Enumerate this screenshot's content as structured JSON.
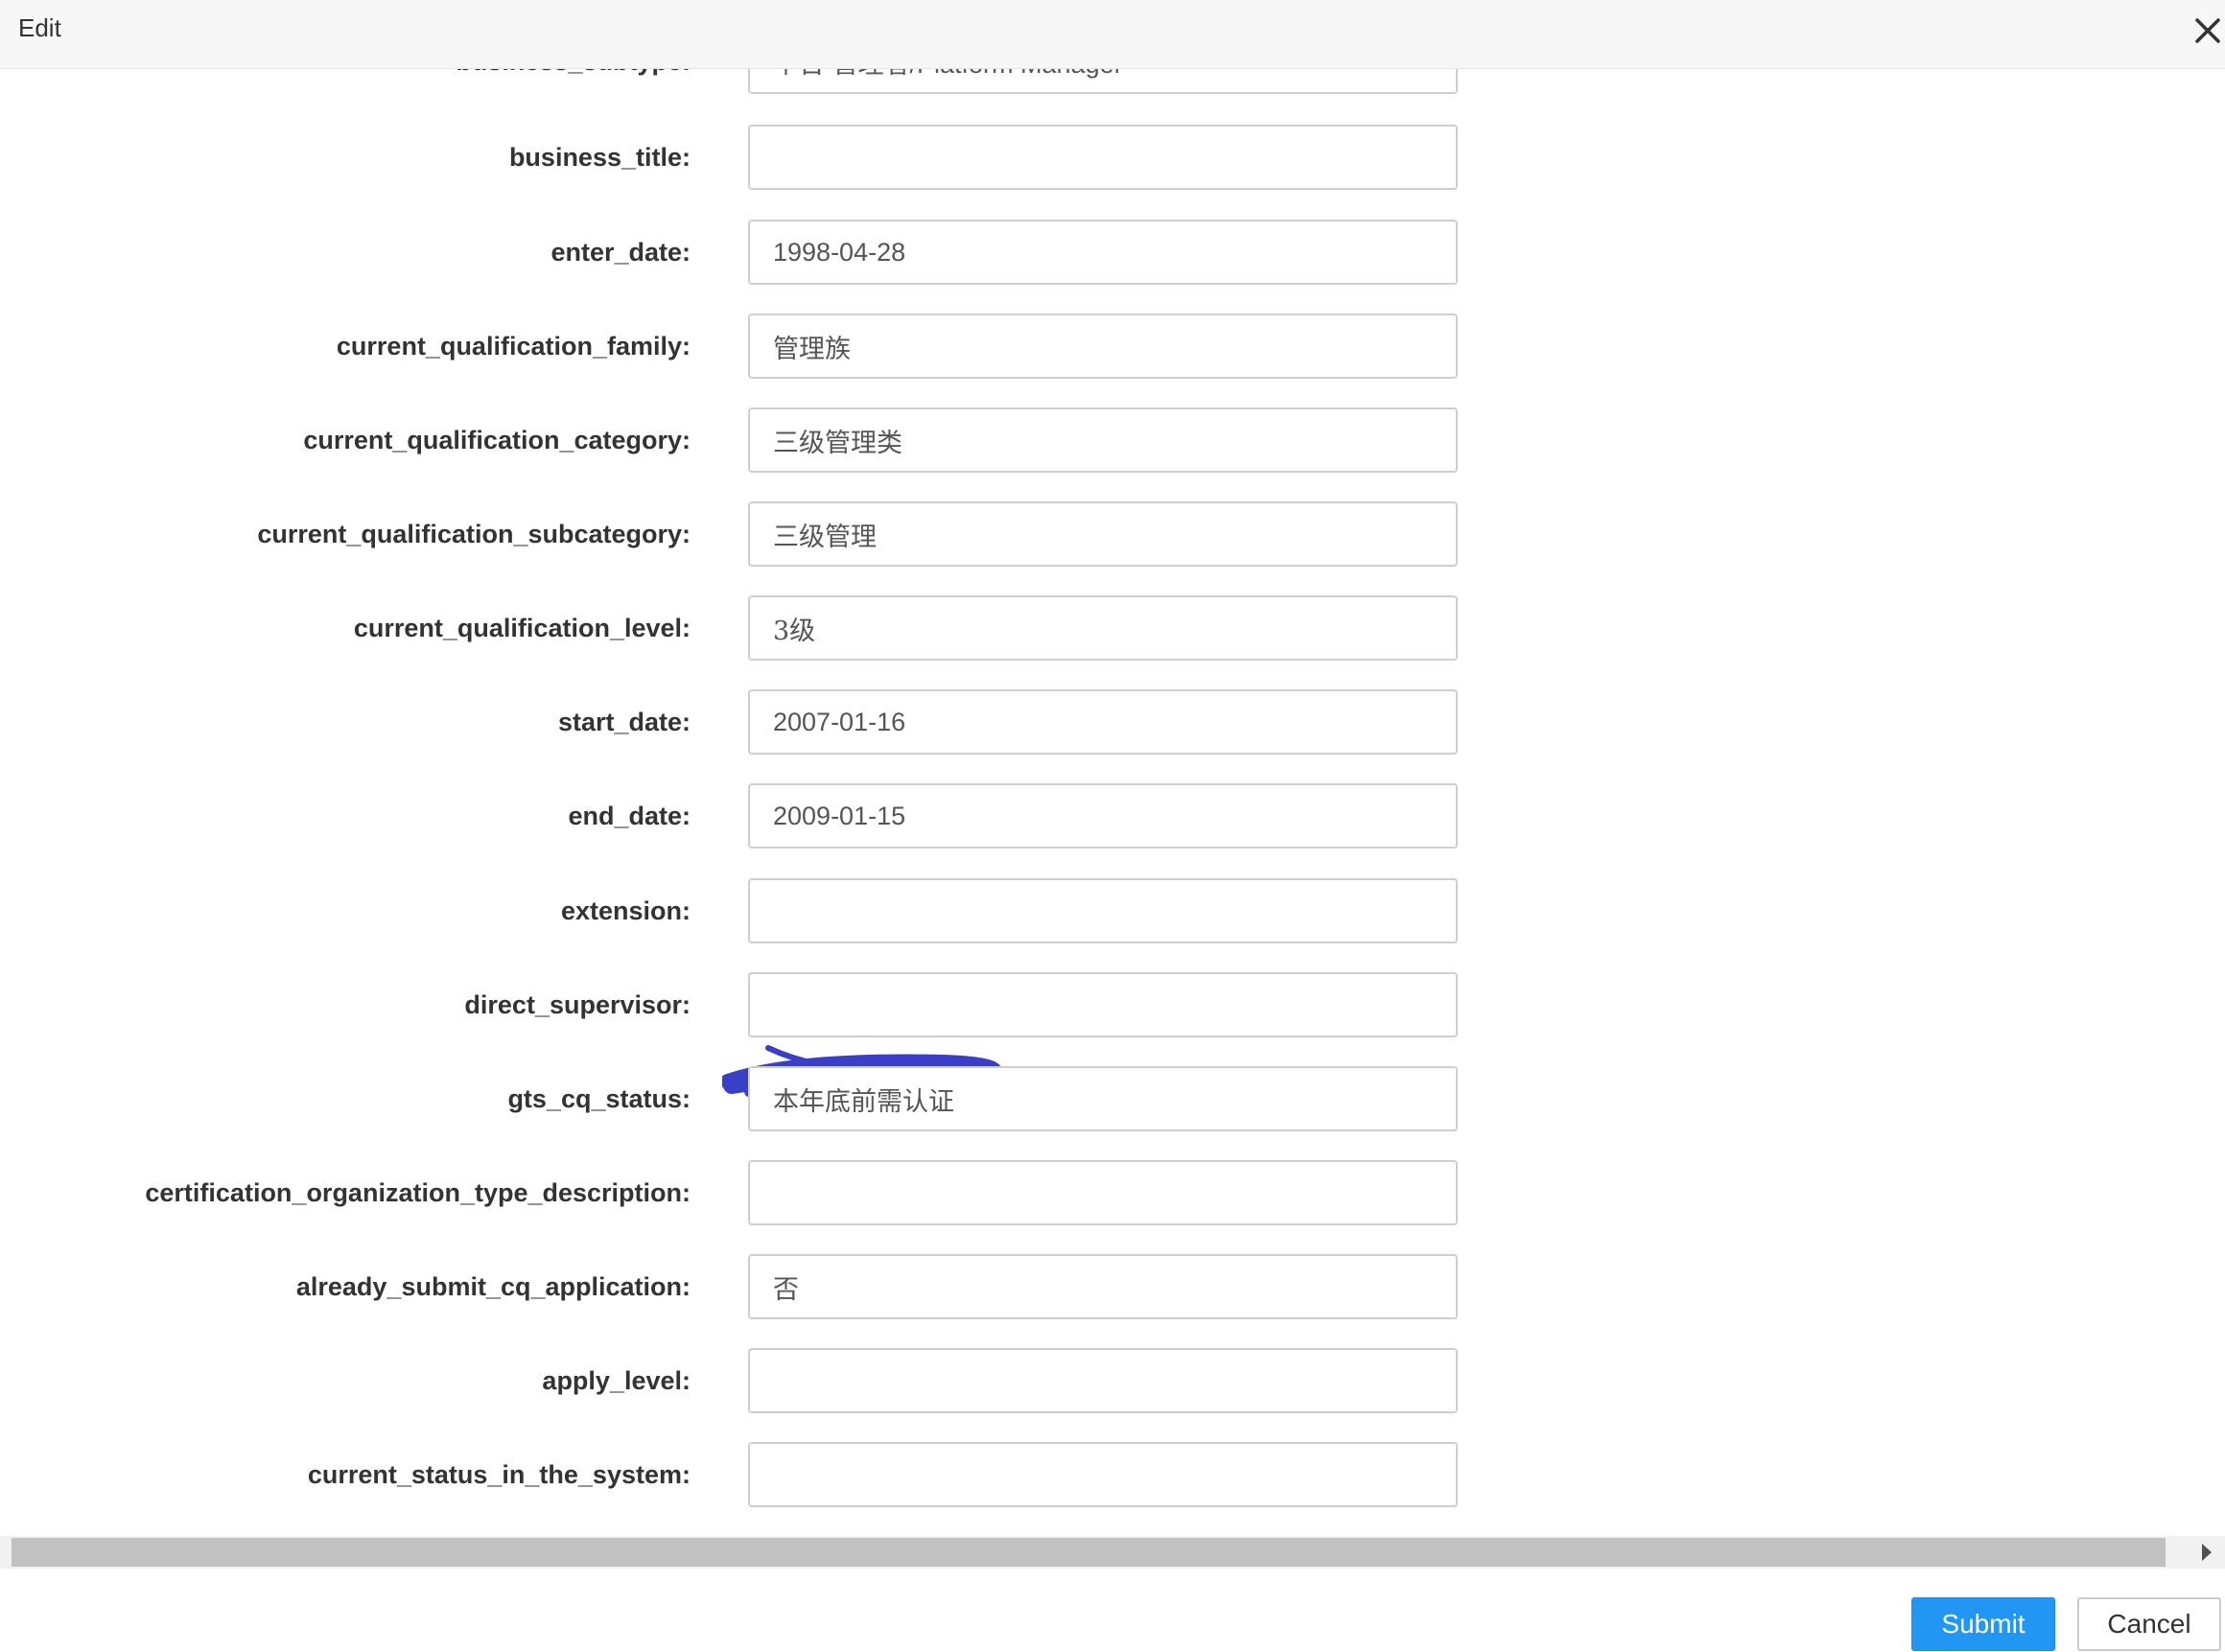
{
  "dialog": {
    "title": "Edit"
  },
  "form": {
    "fields": [
      {
        "label": "business_subtype:",
        "value": "平台 管理者/Platform Manager"
      },
      {
        "label": "business_title:",
        "value": ""
      },
      {
        "label": "enter_date:",
        "value": "1998-04-28"
      },
      {
        "label": "current_qualification_family:",
        "value": "管理族"
      },
      {
        "label": "current_qualification_category:",
        "value": "三级管理类"
      },
      {
        "label": "current_qualification_subcategory:",
        "value": "三级管理"
      },
      {
        "label": "current_qualification_level:",
        "value": "3级"
      },
      {
        "label": "start_date:",
        "value": "2007-01-16"
      },
      {
        "label": "end_date:",
        "value": "2009-01-15"
      },
      {
        "label": "extension:",
        "value": ""
      },
      {
        "label": "direct_supervisor:",
        "value": ""
      },
      {
        "label": "gts_cq_status:",
        "value": "本年底前需认证"
      },
      {
        "label": "certification_organization_type_description:",
        "value": ""
      },
      {
        "label": "already_submit_cq_application:",
        "value": "否"
      },
      {
        "label": "apply_level:",
        "value": ""
      },
      {
        "label": "current_status_in_the_system:",
        "value": ""
      }
    ]
  },
  "footer": {
    "submit_label": "Submit",
    "cancel_label": "Cancel"
  },
  "colors": {
    "primary": "#2196f3",
    "scrub": "#3a3fc8"
  }
}
